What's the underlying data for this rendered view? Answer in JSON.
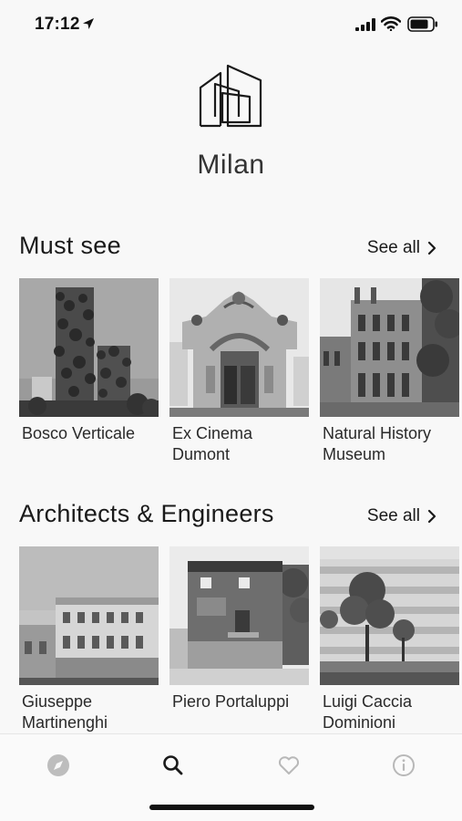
{
  "status_bar": {
    "time": "17:12"
  },
  "header": {
    "city": "Milan"
  },
  "sections": [
    {
      "title": "Must see",
      "see_all": "See all",
      "cards": [
        {
          "label": "Bosco Verticale"
        },
        {
          "label": "Ex Cinema Dumont"
        },
        {
          "label": "Natural History Museum"
        }
      ]
    },
    {
      "title": "Architects & Engineers",
      "see_all": "See all",
      "cards": [
        {
          "label": "Giuseppe Martinenghi"
        },
        {
          "label": "Piero Portaluppi"
        },
        {
          "label": "Luigi Caccia Dominioni"
        }
      ]
    }
  ],
  "tab_bar": {
    "tabs": [
      {
        "icon": "compass-icon",
        "active": false
      },
      {
        "icon": "search-icon",
        "active": true
      },
      {
        "icon": "heart-icon",
        "active": false
      },
      {
        "icon": "info-icon",
        "active": false
      }
    ]
  },
  "colors": {
    "background": "#f8f8f8",
    "text": "#1a1a1a",
    "inactive_tab": "#b8b8b8",
    "active_tab": "#1a1a1a"
  }
}
